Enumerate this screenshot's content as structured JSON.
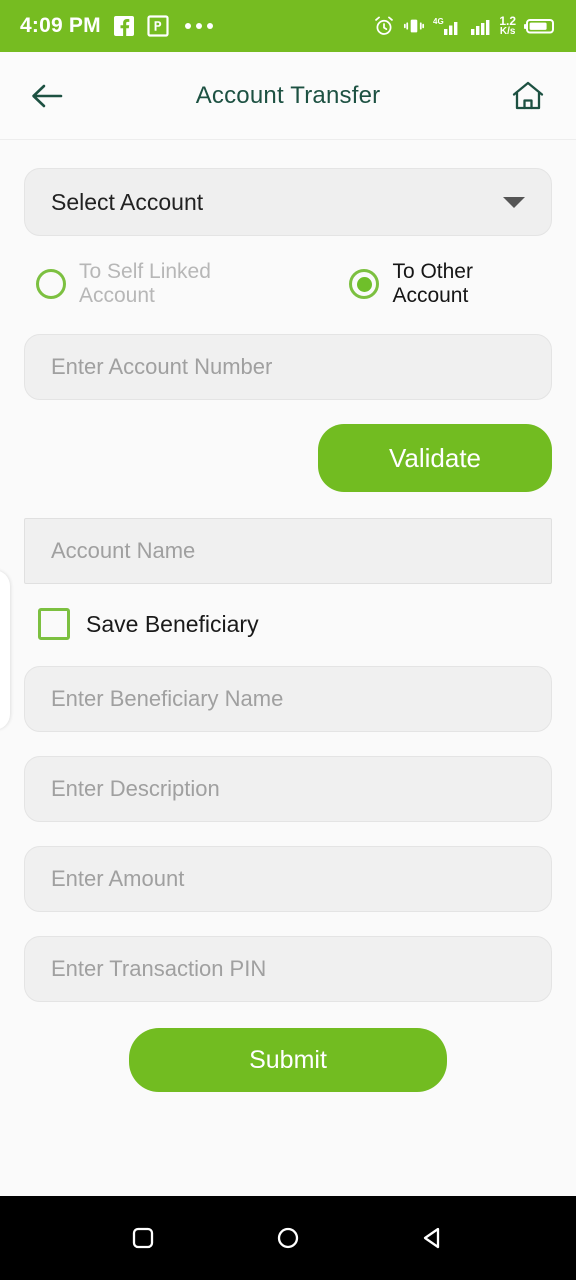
{
  "status_bar": {
    "time": "4:09 PM",
    "background_color": "#76bc21",
    "notification_icons": [
      "facebook-icon",
      "powerpoint-icon",
      "more-notifications-dots"
    ],
    "alarm_icon": "alarm-clock-icon",
    "vibrate_icon": "vibrate-mode-icon",
    "network_type": "4G",
    "signal_icon": "signal-bars-icon",
    "signal_icon_2": "signal-bars-2-icon",
    "net_speed_value": "1.2",
    "net_speed_unit": "K/s",
    "battery_icon": "battery-icon"
  },
  "header": {
    "back_icon": "back-arrow-icon",
    "title": "Account Transfer",
    "home_icon": "home-icon",
    "title_color": "#1d5142"
  },
  "form": {
    "account_select": {
      "value": "Select Account",
      "caret_icon": "chevron-down-icon"
    },
    "transfer_type": {
      "options": [
        {
          "label": "To Self Linked Account",
          "selected": false
        },
        {
          "label": "To Other Account",
          "selected": true
        }
      ]
    },
    "account_number": {
      "placeholder": "Enter Account Number",
      "value": ""
    },
    "validate_button": {
      "label": "Validate"
    },
    "account_name": {
      "placeholder": "Account Name",
      "value": ""
    },
    "save_beneficiary": {
      "label": "Save Beneficiary",
      "checked": false
    },
    "beneficiary_name": {
      "placeholder": "Enter Beneficiary Name",
      "value": ""
    },
    "description": {
      "placeholder": "Enter Description",
      "value": ""
    },
    "amount": {
      "placeholder": "Enter Amount",
      "value": ""
    },
    "transaction_pin": {
      "placeholder": "Enter Transaction PIN",
      "value": ""
    },
    "submit_button": {
      "label": "Submit"
    }
  },
  "colors": {
    "brand_green": "#72bc21",
    "status_green": "#76bc21",
    "header_text": "#1d5142",
    "field_bg": "#f0f0f0",
    "placeholder": "#a0a0a0",
    "page_bg": "#fafafa"
  },
  "nav_bar": {
    "recents_icon": "recents-square-icon",
    "home_icon": "home-circle-icon",
    "back_icon": "back-triangle-icon"
  }
}
